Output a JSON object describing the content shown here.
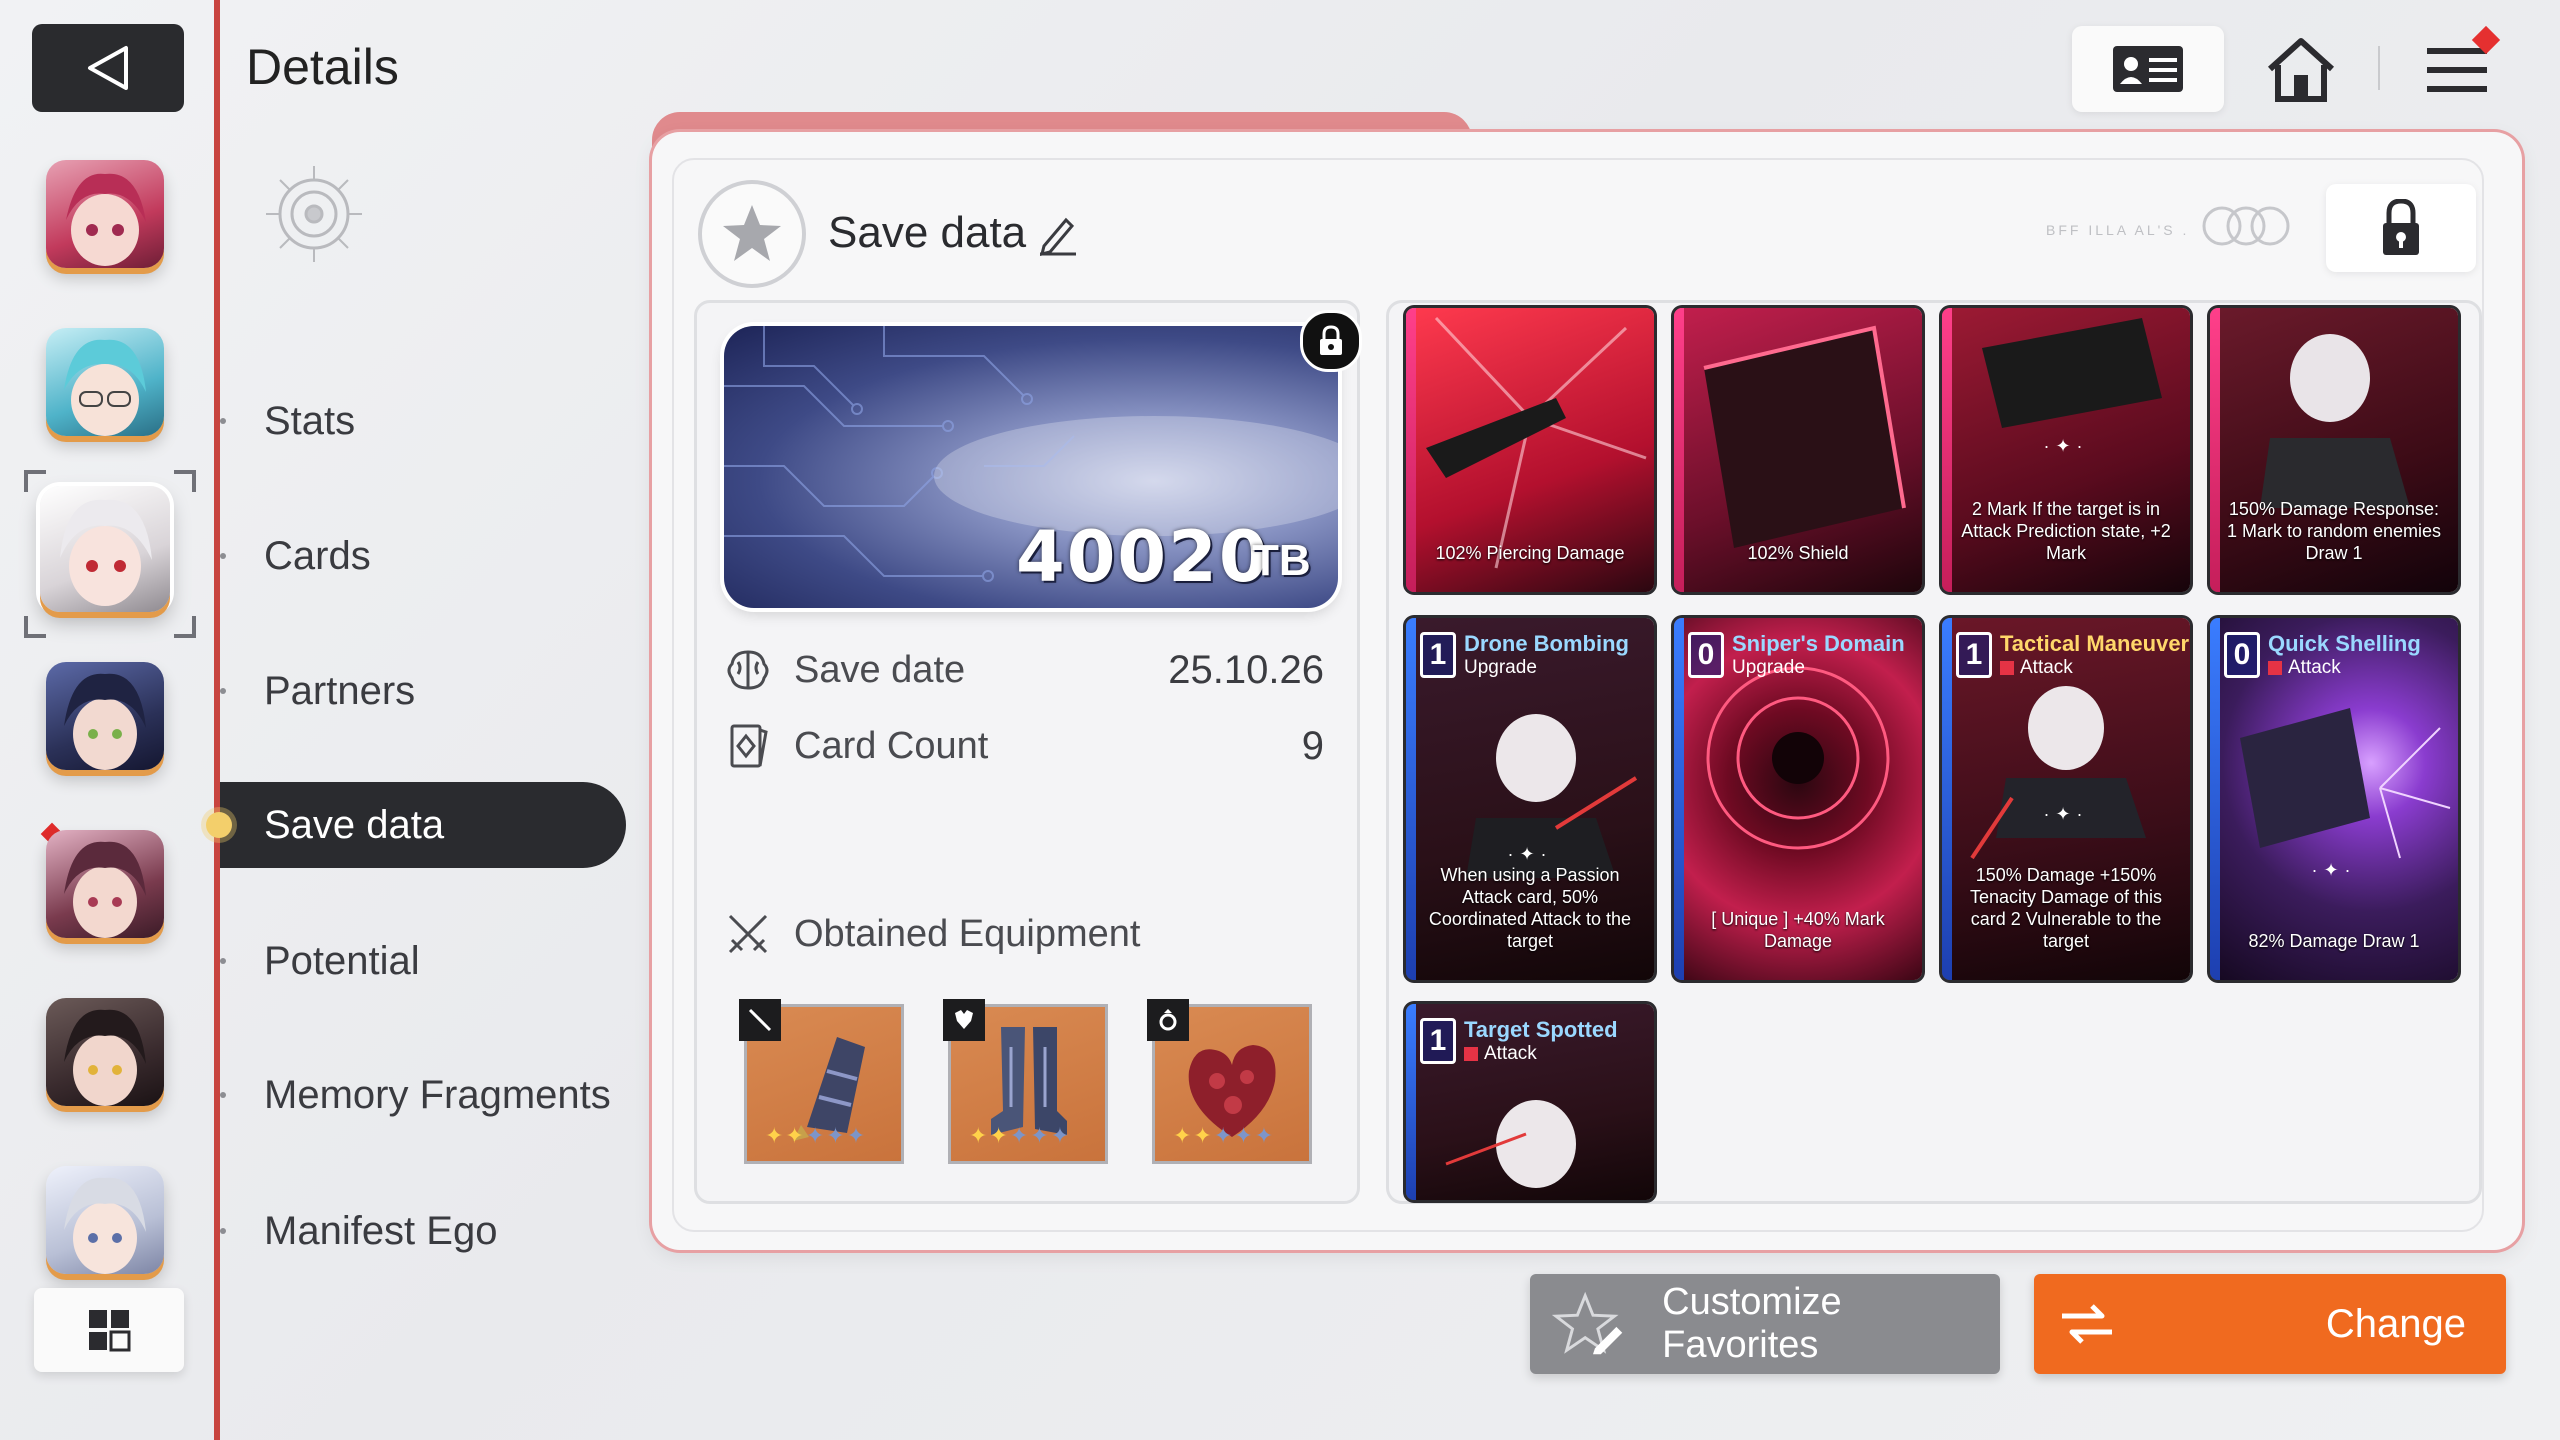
{
  "header": {
    "title": "Details",
    "profile_icon": "id-card-icon",
    "home_icon": "home-icon",
    "menu_icon": "hamburger-menu-icon",
    "notification_color": "#e53030"
  },
  "characters": [
    {
      "name": "character-1",
      "color": "#c23a5c"
    },
    {
      "name": "character-2",
      "color": "#4fb3c9"
    },
    {
      "name": "character-3",
      "color": "#d9d4d8",
      "selected": true
    },
    {
      "name": "character-4",
      "color": "#2b3158"
    },
    {
      "name": "character-5",
      "color": "#7a3b4e"
    },
    {
      "name": "character-6",
      "color": "#3a2b2e"
    },
    {
      "name": "character-7",
      "color": "#b9c0d6"
    }
  ],
  "nav": {
    "items": [
      {
        "label": "Stats"
      },
      {
        "label": "Cards"
      },
      {
        "label": "Partners"
      },
      {
        "label": "Save data",
        "active": true
      },
      {
        "label": "Potential"
      },
      {
        "label": "Memory Fragments"
      },
      {
        "label": "Manifest Ego"
      }
    ]
  },
  "panel": {
    "title": "Save data",
    "mini_text": "BFF ILLA AL'S .",
    "storage_value": "40020",
    "storage_unit": "TB",
    "save_date_label": "Save date",
    "save_date_value": "25.10.26",
    "card_count_label": "Card Count",
    "card_count_value": "9",
    "equipment_title": "Obtained Equipment",
    "equipment": [
      {
        "slot": "weapon",
        "type_icon": "sword-icon",
        "stars_on": 2,
        "stars_total": 5
      },
      {
        "slot": "armor",
        "type_icon": "armor-icon",
        "stars_on": 2,
        "stars_total": 5
      },
      {
        "slot": "accessory",
        "type_icon": "ring-icon",
        "stars_on": 2,
        "stars_total": 5
      }
    ]
  },
  "cards": [
    {
      "desc": "102% Piercing Damage",
      "art": "#b3102e"
    },
    {
      "desc": "102% Shield",
      "art": "#6b0f2a"
    },
    {
      "desc": "2 Mark If the target is in Attack Prediction state, +2 Mark",
      "art": "#5a0b1e"
    },
    {
      "desc": "150% Damage Response: 1 Mark to random enemies Draw 1",
      "art": "#3c0b16"
    },
    {
      "cost": "1",
      "name": "Drone Bombing",
      "type": "Upgrade",
      "desc": "When using a Passion Attack card, 50% Coordinated Attack to the target",
      "art": "#2a1018"
    },
    {
      "cost": "0",
      "name": "Sniper's Domain",
      "type": "Upgrade",
      "desc": "[ Unique ] +40% Mark Damage",
      "art": "#6e0a22"
    },
    {
      "cost": "1",
      "name": "Tactical Maneuver",
      "type": "Attack",
      "desc": "150% Damage +150% Tenacity Damage of this card 2 Vulnerable to the target",
      "art": "#3a0d18"
    },
    {
      "cost": "0",
      "name": "Quick Shelling",
      "type": "Attack",
      "desc": "82% Damage Draw 1",
      "art": "#3b1c5c"
    },
    {
      "cost": "1",
      "name": "Target Spotted",
      "type": "Attack",
      "desc": "",
      "art": "#2a1018"
    }
  ],
  "buttons": {
    "favorites": "Customize Favorites",
    "change": "Change"
  },
  "colors": {
    "accent": "#c8443f",
    "change": "#f06a1f",
    "favorites": "#8a8b8f",
    "card_pink": "#ff3f8a"
  }
}
